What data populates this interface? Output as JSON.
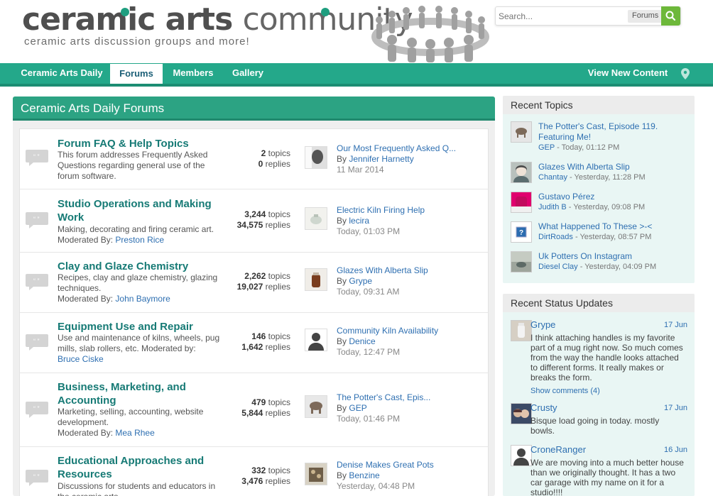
{
  "header": {
    "logo_bold": "ceramic arts",
    "logo_light": "community",
    "tagline": "ceramic arts discussion groups and more!"
  },
  "search": {
    "placeholder": "Search...",
    "scope": "Forums",
    "icon": "search-icon"
  },
  "nav": {
    "items": [
      "Ceramic Arts Daily",
      "Forums",
      "Members",
      "Gallery"
    ],
    "active": "Forums",
    "new_content": "View New Content",
    "location_icon": "map-marker-icon"
  },
  "main": {
    "title": "Ceramic Arts Daily Forums",
    "forums": [
      {
        "title": "Forum FAQ & Help Topics",
        "desc": "This forum addresses Frequently Asked Questions regarding general use of the forum software.",
        "mod_label": "",
        "mod": "",
        "topics": "2",
        "replies": "0",
        "topics_label": "topics",
        "replies_label": "replies",
        "last_title": "Our Most Frequently Asked Q...",
        "by_label": "By",
        "last_by": "Jennifer Harnetty",
        "last_date": "11 Mar 2014"
      },
      {
        "title": "Studio Operations and Making Work",
        "desc": "Making, decorating and firing ceramic art.",
        "mod_label": "Moderated By:",
        "mod": "Preston Rice",
        "topics": "3,244",
        "replies": "34,575",
        "topics_label": "topics",
        "replies_label": "replies",
        "last_title": "Electric Kiln Firing Help",
        "by_label": "By",
        "last_by": "lecira",
        "last_date": "Today, 01:03 PM"
      },
      {
        "title": "Clay and Glaze Chemistry",
        "desc": "Recipes, clay and glaze chemistry, glazing techniques.",
        "mod_label": "Moderated By:",
        "mod": "John Baymore",
        "topics": "2,262",
        "replies": "19,027",
        "topics_label": "topics",
        "replies_label": "replies",
        "last_title": "Glazes With Alberta Slip",
        "by_label": "By",
        "last_by": "Grype",
        "last_date": "Today, 09:31 AM"
      },
      {
        "title": "Equipment Use and Repair",
        "desc": "Use and maintenance of kilns, wheels, pug mills, slab rollers, etc. Moderated by:",
        "mod_label": "",
        "mod": "Bruce Ciske",
        "topics": "146",
        "replies": "1,642",
        "topics_label": "topics",
        "replies_label": "replies",
        "last_title": "Community Kiln Availability",
        "by_label": "By",
        "last_by": "Denice",
        "last_date": "Today, 12:47 PM"
      },
      {
        "title": "Business, Marketing, and Accounting",
        "desc": "Marketing, selling, accounting, website development.",
        "mod_label": "Moderated By:",
        "mod": "Mea Rhee",
        "topics": "479",
        "replies": "5,844",
        "topics_label": "topics",
        "replies_label": "replies",
        "last_title": "The Potter's Cast, Epis...",
        "by_label": "By",
        "last_by": "GEP",
        "last_date": "Today, 01:46 PM"
      },
      {
        "title": "Educational Approaches and Resources",
        "desc": "Discussions for students and educators in the ceramic arts.",
        "mod_label": "",
        "mod": "",
        "topics": "332",
        "replies": "3,476",
        "topics_label": "topics",
        "replies_label": "replies",
        "last_title": "Denise Makes Great Pots",
        "by_label": "By",
        "last_by": "Benzine",
        "last_date": "Yesterday, 04:48 PM"
      }
    ]
  },
  "recent_topics": {
    "title": "Recent Topics",
    "items": [
      {
        "title": "The Potter's Cast, Episode 119. Featuring Me!",
        "user": "GEP",
        "date": " - Today, 01:12 PM"
      },
      {
        "title": "Glazes With Alberta Slip",
        "user": "Chantay",
        "date": " - Yesterday, 11:28 PM"
      },
      {
        "title": "Gustavo Pérez",
        "user": "Judith B",
        "date": " - Yesterday, 09:08 PM"
      },
      {
        "title": "What Happened To These >-<",
        "user": "DirtRoads",
        "date": " - Yesterday, 08:57 PM"
      },
      {
        "title": "Uk Potters On Instagram",
        "user": "Diesel Clay",
        "date": " - Yesterday, 04:09 PM"
      }
    ]
  },
  "recent_status": {
    "title": "Recent Status Updates",
    "items": [
      {
        "user": "Grype",
        "date": "17 Jun",
        "text": "I think attaching handles is my favorite part of a mug right now. So much comes from the way the handle looks attached to different forms. It really makes or breaks the form.",
        "more": "Show comments (4)"
      },
      {
        "user": "Crusty",
        "date": "17 Jun",
        "text": "Bisque load going in today. mostly bowls.",
        "more": ""
      },
      {
        "user": "CroneRanger",
        "date": "16 Jun",
        "text": "We are moving into a much better house than we originally thought. It has a two car garage with my name on it for a studio!!!!",
        "more": ""
      }
    ]
  },
  "colors": {
    "brand_green": "#24a88a",
    "panel_green": "#2ca383",
    "link_blue": "#2e6fb1",
    "forum_title": "#167a75",
    "search_green": "#6db83a"
  }
}
